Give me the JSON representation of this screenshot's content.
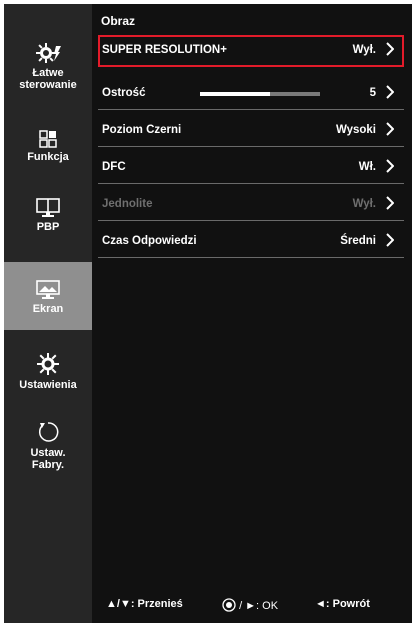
{
  "sidebar": {
    "items": [
      {
        "label_line1": "Łatwe",
        "label_line2": "sterowanie",
        "icon": "gear-easy-icon"
      },
      {
        "label_line1": "Funkcja",
        "label_line2": "",
        "icon": "function-grid-icon"
      },
      {
        "label_line1": "PBP",
        "label_line2": "",
        "icon": "pbp-monitor-icon"
      },
      {
        "label_line1": "Ekran",
        "label_line2": "",
        "icon": "picture-monitor-icon",
        "active": true
      },
      {
        "label_line1": "Ustawienia",
        "label_line2": "",
        "icon": "gear-icon"
      },
      {
        "label_line1": "Ustaw.",
        "label_line2": "Fabry.",
        "icon": "reset-icon"
      }
    ]
  },
  "main": {
    "title": "Obraz",
    "rows": [
      {
        "label": "SUPER RESOLUTION+",
        "value": "Wył.",
        "selected": true
      },
      {
        "label": "Ostrość",
        "value": "5",
        "slider_fraction": 0.58
      },
      {
        "label": "Poziom Czerni",
        "value": "Wysoki"
      },
      {
        "label": "DFC",
        "value": "Wł."
      },
      {
        "label": "Jednolite",
        "value": "Wył.",
        "disabled": true
      },
      {
        "label": "Czas Odpowiedzi",
        "value": "Średni"
      }
    ]
  },
  "footer": {
    "move": "▲/▼: Przenieś",
    "ok_suffix": "/ ►: OK",
    "back": "◄: Powrót"
  },
  "colors": {
    "selection_border": "#e31b2a",
    "active_sidebar": "#8f8f8f",
    "background": "#111111"
  }
}
